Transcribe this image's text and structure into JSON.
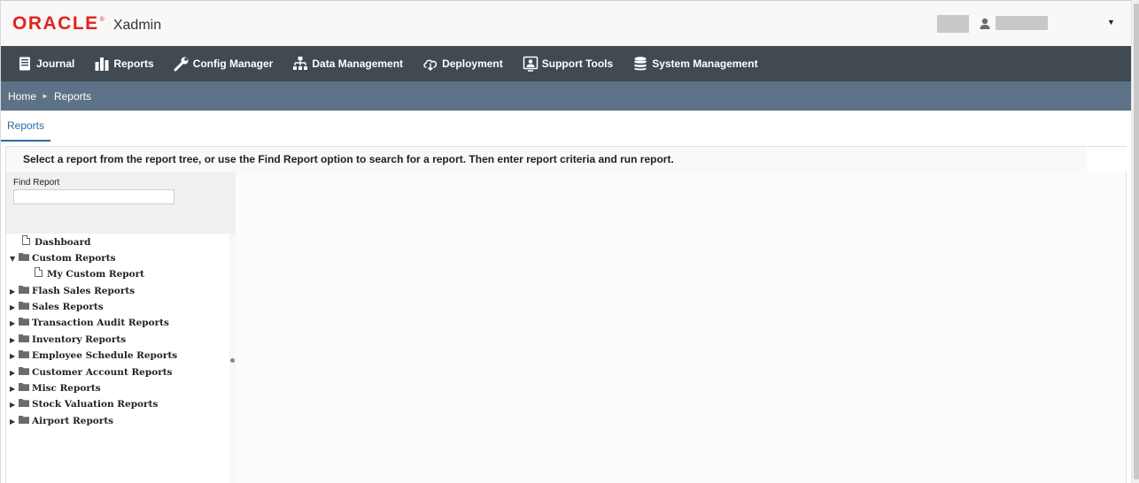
{
  "header": {
    "brand": "ORACLE",
    "brand_mark": "®",
    "app_name": "Xadmin",
    "user_icon": "user-icon",
    "menu_caret": "▼"
  },
  "nav": {
    "items": [
      {
        "label": "Journal",
        "icon": "journal-icon"
      },
      {
        "label": "Reports",
        "icon": "bar-chart-icon"
      },
      {
        "label": "Config Manager",
        "icon": "wrench-icon"
      },
      {
        "label": "Data Management",
        "icon": "hierarchy-icon"
      },
      {
        "label": "Deployment",
        "icon": "cloud-download-icon"
      },
      {
        "label": "Support Tools",
        "icon": "support-icon"
      },
      {
        "label": "System Management",
        "icon": "database-icon"
      }
    ]
  },
  "breadcrumb": {
    "home": "Home",
    "separator": "►",
    "current": "Reports"
  },
  "tabs": {
    "active": "Reports"
  },
  "instructions": "Select a report from the report tree, or use the Find Report option to search for a report. Then enter report criteria and run report.",
  "find": {
    "label": "Find Report",
    "value": ""
  },
  "tree": {
    "dashboard": "Dashboard",
    "custom_reports": "Custom Reports",
    "my_custom_report": "My Custom Report",
    "flash_sales": "Flash Sales Reports",
    "sales": "Sales Reports",
    "transaction_audit": "Transaction Audit Reports",
    "inventory": "Inventory Reports",
    "employee_schedule": "Employee Schedule Reports",
    "customer_account": "Customer Account Reports",
    "misc": "Misc Reports",
    "stock_valuation": "Stock Valuation Reports",
    "airport": "Airport Reports",
    "expanded_toggle": "▼",
    "collapsed_toggle": "▶"
  },
  "colors": {
    "brand_red": "#e2231a",
    "navbar": "#404a50",
    "breadcrumb": "#5d7286",
    "tab_accent": "#2a6ca5"
  }
}
